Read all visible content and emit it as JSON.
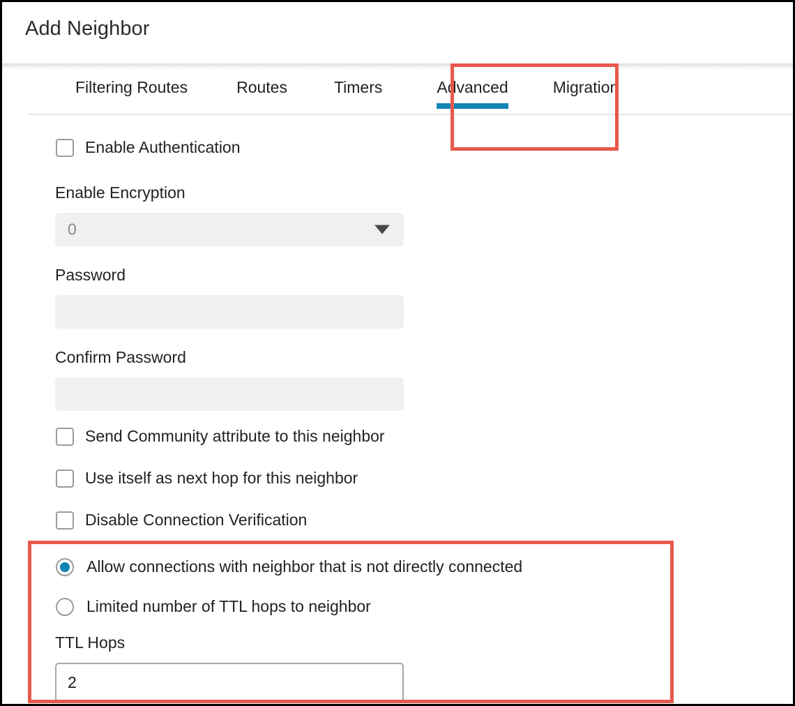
{
  "window": {
    "title": "Add Neighbor"
  },
  "tabs": [
    {
      "label": "Filtering Routes",
      "active": false
    },
    {
      "label": "Routes",
      "active": false
    },
    {
      "label": "Timers",
      "active": false
    },
    {
      "label": "Advanced",
      "active": true
    },
    {
      "label": "Migration",
      "active": false
    }
  ],
  "form": {
    "enable_authentication": {
      "label": "Enable Authentication",
      "checked": false
    },
    "enable_encryption": {
      "label": "Enable Encryption",
      "value": "0",
      "disabled": true
    },
    "password": {
      "label": "Password",
      "value": "",
      "disabled": true
    },
    "confirm_password": {
      "label": "Confirm Password",
      "value": "",
      "disabled": true
    },
    "send_community": {
      "label": "Send Community attribute to this neighbor",
      "checked": false
    },
    "use_itself_next_hop": {
      "label": "Use itself as next hop for this neighbor",
      "checked": false
    },
    "disable_connection_verification": {
      "label": "Disable Connection Verification",
      "checked": false
    },
    "allow_connections": {
      "label": "Allow connections with neighbor that is not directly connected",
      "selected": true
    },
    "limited_ttl_hops": {
      "label": "Limited number of TTL hops to neighbor",
      "selected": false
    },
    "ttl_hops": {
      "label": "TTL Hops",
      "value": "2"
    }
  },
  "colors": {
    "accent_blue": "#1184b4",
    "annotation_red": "#e8584c",
    "disabled_field": "#f0f0f0",
    "text": "#222222"
  },
  "annotations": [
    {
      "name": "advanced-tab-highlight"
    },
    {
      "name": "ttl-section-highlight"
    }
  ]
}
